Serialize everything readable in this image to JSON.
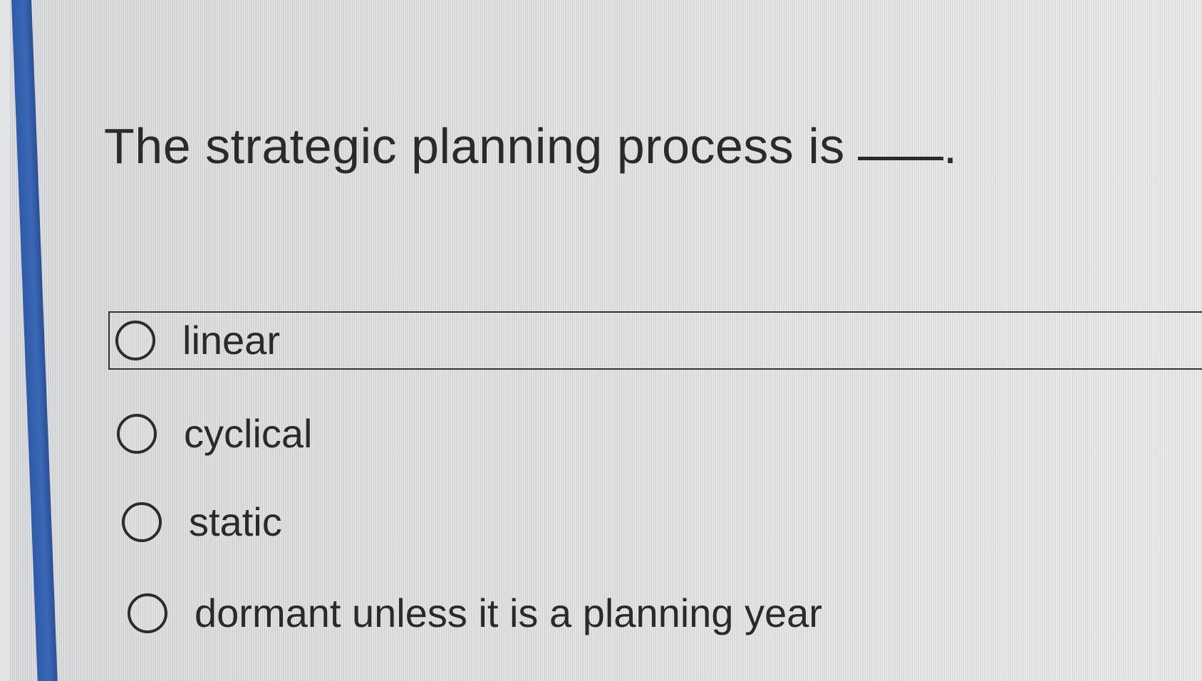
{
  "question": {
    "text": "The strategic planning process is",
    "punctuation": "."
  },
  "options": [
    {
      "label": "linear",
      "selected": false
    },
    {
      "label": "cyclical",
      "selected": false
    },
    {
      "label": "static",
      "selected": false
    },
    {
      "label": "dormant unless it is a planning year",
      "selected": false
    }
  ],
  "colors": {
    "accent_bar": "#3a68b7",
    "text": "#2a2a2c",
    "background": "#dcdee0"
  }
}
